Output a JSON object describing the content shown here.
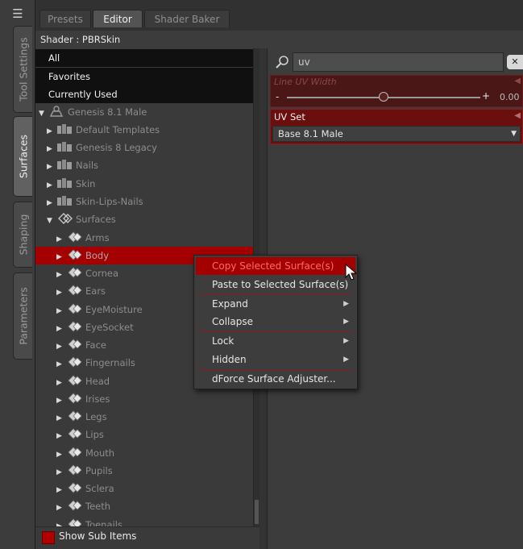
{
  "window": {
    "menu_icon": "menu-icon"
  },
  "vertical_tabs": [
    {
      "label": "Tool Settings",
      "active": false
    },
    {
      "label": "Surfaces",
      "active": true
    },
    {
      "label": "Shaping",
      "active": false
    },
    {
      "label": "Parameters",
      "active": false
    }
  ],
  "tabs": [
    {
      "label": "Presets",
      "active": false
    },
    {
      "label": "Editor",
      "active": true
    },
    {
      "label": "Shader Baker",
      "active": false
    }
  ],
  "shader_label": "Shader : PBRSkin",
  "filters": [
    "All",
    "Favorites",
    "Currently Used"
  ],
  "tree": {
    "figure": "Genesis 8.1 Male",
    "groups": [
      "Default Templates",
      "Genesis 8 Legacy",
      "Nails",
      "Skin",
      "Skin-Lips-Nails"
    ],
    "surfaces_group": "Surfaces",
    "surfaces": [
      "Arms",
      "Body",
      "Cornea",
      "Ears",
      "EyeMoisture",
      "EyeSocket",
      "Face",
      "Fingernails",
      "Head",
      "Irises",
      "Legs",
      "Lips",
      "Mouth",
      "Pupils",
      "Sclera",
      "Teeth",
      "Toenails"
    ],
    "selected": "Body"
  },
  "search": {
    "value": "uv",
    "clear_icon": "clear-icon"
  },
  "properties": {
    "line_uv_width": {
      "label": "Line UV Width",
      "value": "0.00",
      "level": 0.5
    },
    "uv_set": {
      "label": "UV Set",
      "value": "Base 8.1 Male"
    }
  },
  "show_sub_items": {
    "label": "Show Sub Items",
    "checked": true
  },
  "context_menu": {
    "items": [
      {
        "label": "Copy Selected Surface(s)",
        "highlighted": true,
        "submenu": false
      },
      {
        "label": "Paste to Selected Surface(s)",
        "highlighted": false,
        "submenu": false
      },
      {
        "label": "Expand",
        "highlighted": false,
        "submenu": true
      },
      {
        "label": "Collapse",
        "highlighted": false,
        "submenu": true
      },
      {
        "label": "Lock",
        "highlighted": false,
        "submenu": true
      },
      {
        "label": "Hidden",
        "highlighted": false,
        "submenu": true
      },
      {
        "label": "dForce Surface Adjuster...",
        "highlighted": false,
        "submenu": false
      }
    ]
  },
  "colors": {
    "accent_red": "#a40000",
    "panel": "#3a3a3a",
    "filter_bg": "#101010"
  }
}
